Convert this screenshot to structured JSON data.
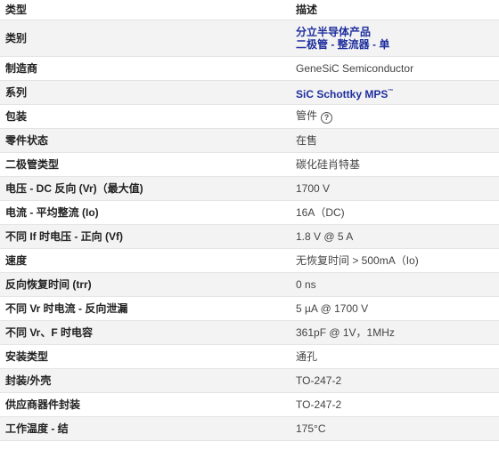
{
  "header": {
    "type": "类型",
    "description": "描述"
  },
  "rows": {
    "category": {
      "label": "类别",
      "line1": "分立半导体产品",
      "line2": "二极管 - 整流器 - 单"
    },
    "manufacturer": {
      "label": "制造商",
      "value": "GeneSiC Semiconductor"
    },
    "series": {
      "label": "系列",
      "value": "SiC Schottky MPS",
      "tm": "™"
    },
    "package": {
      "label": "包装",
      "value": "管件",
      "help": "?"
    },
    "status": {
      "label": "零件状态",
      "value": "在售"
    },
    "diode_type": {
      "label": "二极管类型",
      "value": "碳化硅肖特基"
    },
    "voltage_dc": {
      "label": "电压 - DC 反向 (Vr)（最大值)",
      "value": "1700 V"
    },
    "current_avg": {
      "label": "电流 - 平均整流 (Io)",
      "value": "16A（DC)"
    },
    "vf": {
      "label": "不同 If 时电压 - 正向 (Vf)",
      "value": "1.8 V @ 5 A"
    },
    "speed": {
      "label": "速度",
      "value": "无恢复时间 > 500mA（Io)"
    },
    "trr": {
      "label": "反向恢复时间 (trr)",
      "value": "0 ns"
    },
    "leakage": {
      "label": "不同 Vr 时电流 - 反向泄漏",
      "value": "5 µA @ 1700 V"
    },
    "capacitance": {
      "label": "不同 Vr、F 时电容",
      "value": "361pF @ 1V，1MHz"
    },
    "mounting": {
      "label": "安装类型",
      "value": "通孔"
    },
    "case": {
      "label": "封装/外壳",
      "value": "TO-247-2"
    },
    "supplier_pkg": {
      "label": "供应商器件封装",
      "value": "TO-247-2"
    },
    "temp": {
      "label": "工作温度 - 结",
      "value": "175°C"
    }
  }
}
